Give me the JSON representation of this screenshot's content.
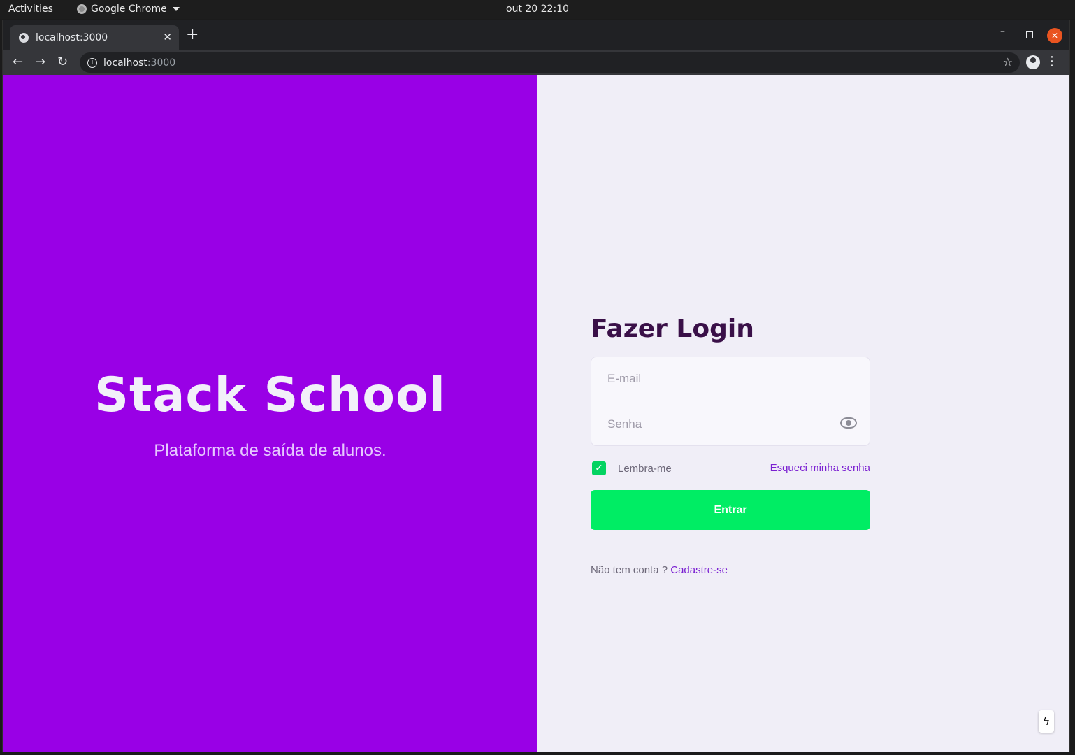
{
  "system": {
    "activities": "Activities",
    "app_name": "Google Chrome",
    "clock": "out 20  22:10"
  },
  "browser": {
    "tab_title": "localhost:3000",
    "url_host": "localhost",
    "url_port": ":3000"
  },
  "brand": {
    "title": "Stack School",
    "tagline": "Plataforma de saída de alunos."
  },
  "login": {
    "title": "Fazer Login",
    "email_placeholder": "E-mail",
    "password_placeholder": "Senha",
    "remember_label": "Lembra-me",
    "remember_checked": true,
    "forgot_label": "Esqueci minha senha",
    "submit_label": "Entrar",
    "signup_prompt": "Não tem conta ?",
    "signup_link": "Cadastre-se"
  },
  "colors": {
    "brand_purple": "#9900e6",
    "panel_bg": "#f0eef7",
    "accent_green": "#00ed64",
    "link_purple": "#7a1fd1",
    "title_dark": "#3a1048"
  },
  "icons": {
    "password_toggle": "eye-icon",
    "dev_indicator": "bolt-icon"
  }
}
